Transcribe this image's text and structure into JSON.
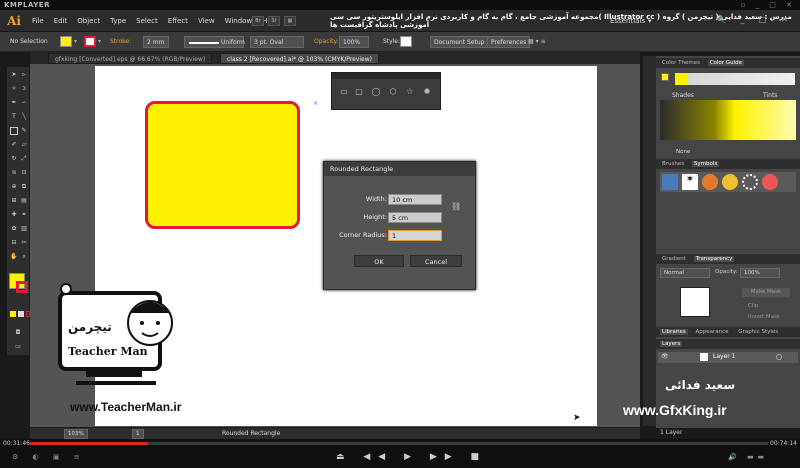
{
  "player": {
    "brand": "KMPLAYER",
    "time_current": "00:31:46",
    "time_total": "00:74:14",
    "progress_fraction": 0.16
  },
  "app": {
    "logo": "Ai",
    "menus": [
      "File",
      "Edit",
      "Object",
      "Type",
      "Select",
      "Effect",
      "View",
      "Window",
      "Help"
    ],
    "course_title": "مجموعه آموزشی جامع ، گام به گام و کاربردی نرم افزار ایلوستریتور سی سی( Illustrator cc )   مدرس : سعید فدایی ( تیچرمن ) گروه آموزشی پادشاه گرافیست ها",
    "workspace": "Essentials"
  },
  "control_bar": {
    "selection": "No Selection",
    "stroke_label": "Stroke:",
    "stroke_value": "2 mm",
    "profile": "Uniform",
    "brush": "3 pt. Oval",
    "opacity_label": "Opacity:",
    "opacity_value": "100%",
    "style_label": "Style:",
    "doc_setup": "Document Setup",
    "preferences": "Preferences"
  },
  "tabs": [
    {
      "label": "gfxking [Converted].eps @ 66.67% (RGB/Preview)",
      "active": false
    },
    {
      "label": "class 2 [Recovered].ai* @ 103% (CMYK/Preview)",
      "active": true
    }
  ],
  "dialog": {
    "title": "Rounded Rectangle",
    "width_label": "Width:",
    "width_value": "10 cm",
    "height_label": "Height:",
    "height_value": "5 cm",
    "radius_label": "Corner Radius:",
    "radius_value": "1",
    "ok": "OK",
    "cancel": "Cancel"
  },
  "panels": {
    "color_tabs": [
      "Color Themes",
      "Color Guide"
    ],
    "shades": "Shades",
    "tints": "Tints",
    "none": "None",
    "brush_tabs": [
      "Brushes",
      "Symbols"
    ],
    "gradient_tabs": [
      "Gradient",
      "Transparency"
    ],
    "blend_mode": "Normal",
    "opacity_label": "Opacity:",
    "opacity_value": "100%",
    "make_mask": "Make Mask",
    "clip": "Clip",
    "invert_mask": "Invert Mask",
    "lib_tabs": [
      "Libraries",
      "Appearance",
      "Graphic Styles"
    ],
    "layers_tab": "Layers",
    "layer_name": "Layer 1",
    "layer_count": "1 Layer"
  },
  "status": {
    "zoom": "103%",
    "page": "1",
    "tool": "Rounded Rectangle"
  },
  "watermarks": {
    "teacherman_url": "www.TeacherMan.ir",
    "teacherman_name": "Teacher Man",
    "teacherman_fa": "تیچرمن",
    "gfxking_url": "www.GfxKing.ir",
    "signature_fa": "سعید فدائی"
  },
  "colors": {
    "fill": "#fff200",
    "stroke": "#e21a3a",
    "accent": "#f9a21b"
  }
}
